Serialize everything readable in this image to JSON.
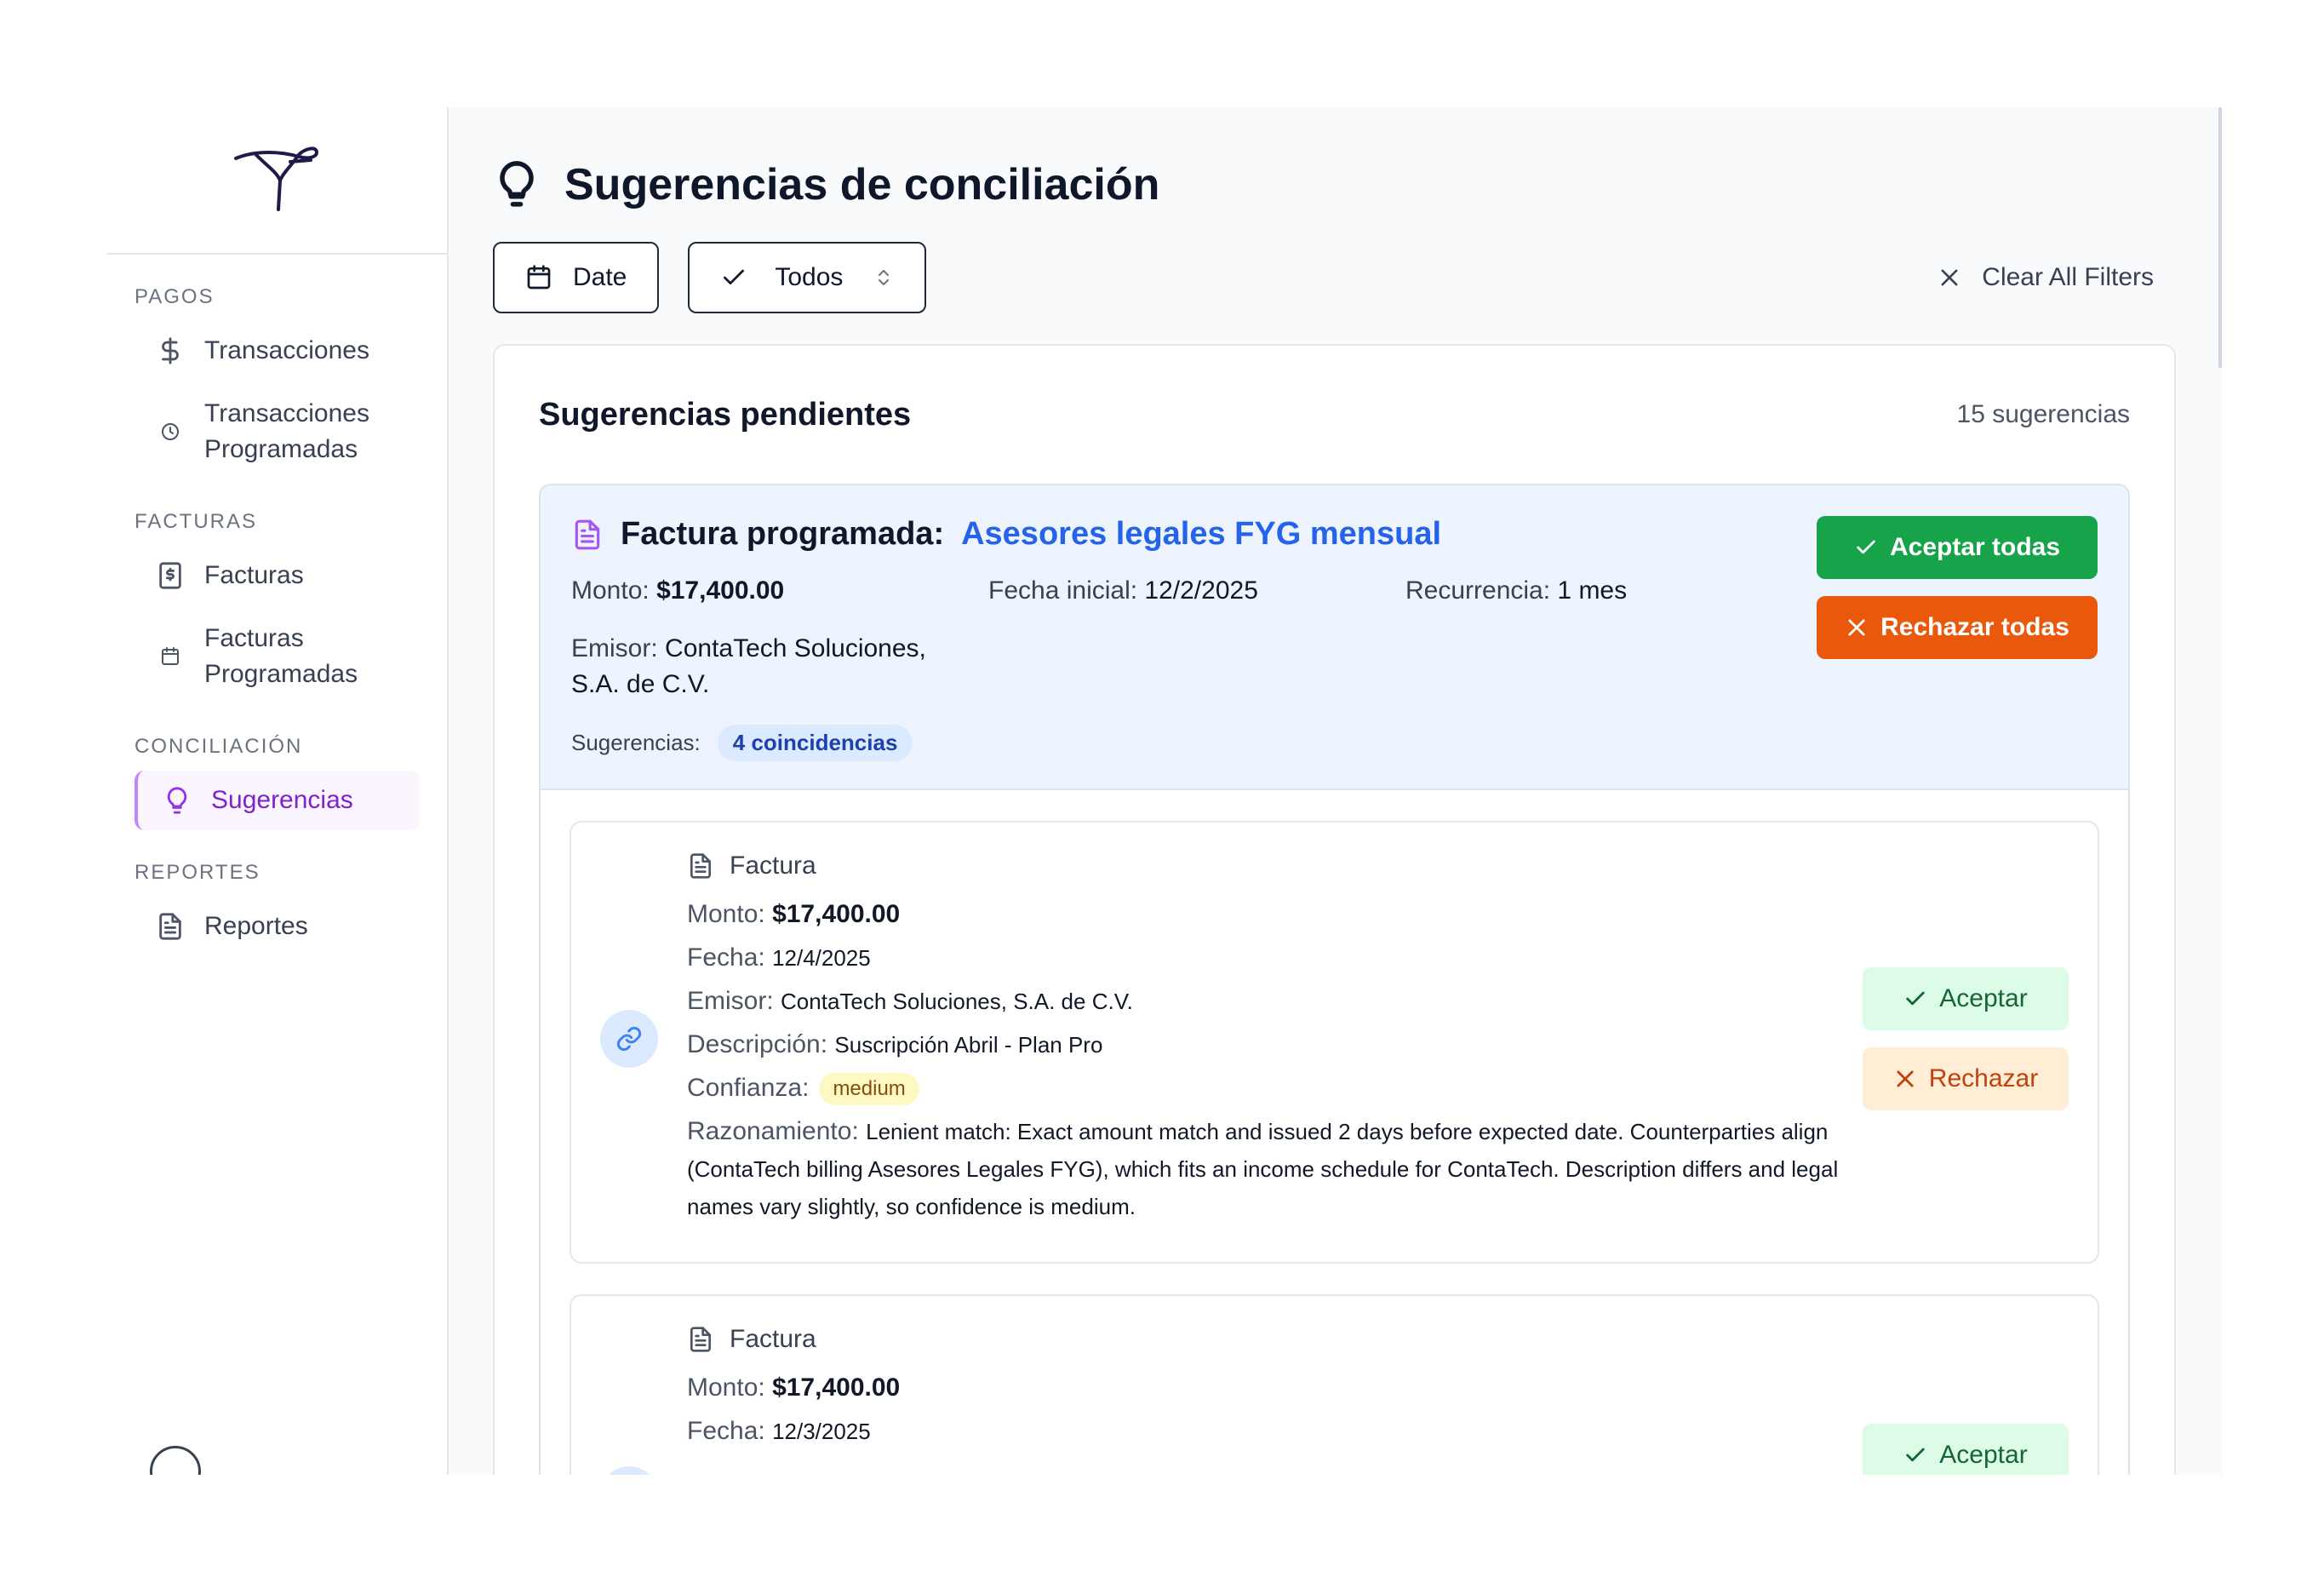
{
  "sidebar": {
    "sections": [
      {
        "heading": "PAGOS",
        "items": [
          {
            "label": "Transacciones",
            "icon": "dollar-icon"
          },
          {
            "label": "Transacciones Programadas",
            "icon": "clock-icon"
          }
        ]
      },
      {
        "heading": "FACTURAS",
        "items": [
          {
            "label": "Facturas",
            "icon": "receipt-icon"
          },
          {
            "label": "Facturas Programadas",
            "icon": "calendar-icon"
          }
        ]
      },
      {
        "heading": "CONCILIACIÓN",
        "items": [
          {
            "label": "Sugerencias",
            "icon": "lightbulb-icon",
            "active": true
          }
        ]
      },
      {
        "heading": "REPORTES",
        "items": [
          {
            "label": "Reportes",
            "icon": "file-text-icon"
          }
        ]
      }
    ],
    "active_color": "#9333ea"
  },
  "header": {
    "title": "Sugerencias de conciliación",
    "icon": "lightbulb-icon"
  },
  "filters": {
    "date_label": "Date",
    "status_label": "Todos",
    "clear_label": "Clear All Filters"
  },
  "card": {
    "title": "Sugerencias pendientes",
    "count": "15 sugerencias",
    "group": {
      "title_prefix": "Factura programada:",
      "title_link": "Asesores legales FYG mensual",
      "monto_label": "Monto:",
      "monto_value": "$17,400.00",
      "fecha_label": "Fecha inicial:",
      "fecha_value": "12/2/2025",
      "recurrencia_label": "Recurrencia:",
      "recurrencia_value": "1 mes",
      "emisor_label": "Emisor:",
      "emisor_value": "ContaTech Soluciones, S.A. de C.V.",
      "sugerencias_label": "Sugerencias:",
      "coincidencias": "4 coincidencias",
      "accept_all": "Aceptar todas",
      "reject_all": "Rechazar todas",
      "colors": {
        "accept": "#16a34a",
        "reject": "#ea580c",
        "link": "#2563eb"
      }
    },
    "suggestions": [
      {
        "type": "Factura",
        "monto_label": "Monto:",
        "monto": "$17,400.00",
        "fecha_label": "Fecha:",
        "fecha": "12/4/2025",
        "emisor_label": "Emisor:",
        "emisor": "ContaTech Soluciones, S.A. de C.V.",
        "descripcion_label": "Descripción:",
        "descripcion": "Suscripción Abril - Plan Pro",
        "confianza_label": "Confianza:",
        "confianza": "medium",
        "razonamiento_label": "Razonamiento:",
        "razonamiento": "Lenient match: Exact amount match and issued 2 days before expected date. Counterparties align (ContaTech billing Asesores Legales FYG), which fits an income schedule for ContaTech. Description differs and legal names vary slightly, so confidence is medium.",
        "accept": "Aceptar",
        "reject": "Rechazar"
      },
      {
        "type": "Factura",
        "monto_label": "Monto:",
        "monto": "$17,400.00",
        "fecha_label": "Fecha:",
        "fecha": "12/3/2025",
        "accept": "Aceptar"
      }
    ]
  }
}
